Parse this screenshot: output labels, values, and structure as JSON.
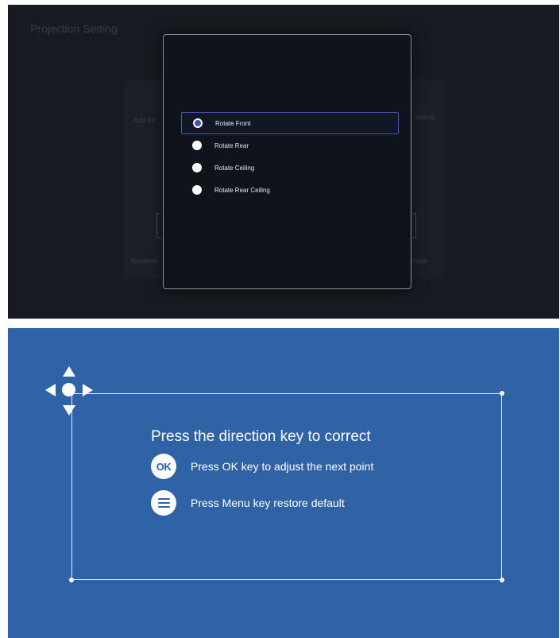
{
  "top": {
    "background_title": "Projection Setting",
    "background_labels": [
      "Auto Ke",
      "Setting",
      "Keystone",
      "Zoom"
    ],
    "options": [
      {
        "label": "Rotate Front",
        "selected": true
      },
      {
        "label": "Rotate Rear",
        "selected": false
      },
      {
        "label": "Rotate Ceiling",
        "selected": false
      },
      {
        "label": "Rotate Rear Ceiling",
        "selected": false
      }
    ],
    "colors": {
      "background": "#171a20",
      "dialog_border": "#7f92ab",
      "selection_border": "#3c5fa8"
    }
  },
  "bottom": {
    "instruction": "Press the direction key to correct",
    "ok_hint": {
      "key": "OK",
      "text": "Press OK key to adjust the next point",
      "icon": "ok-key-icon"
    },
    "menu_hint": {
      "text": "Press Menu key restore default",
      "icon": "menu-key-icon"
    },
    "direction_icon": "dpad-arrows-icon",
    "colors": {
      "background": "#2f63a5",
      "frame": "#e8eef7"
    }
  }
}
